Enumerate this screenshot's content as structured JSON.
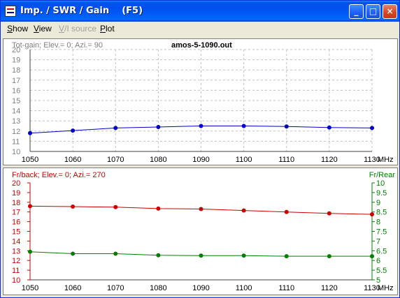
{
  "window": {
    "title": "Imp. / SWR / Gain    (F5)",
    "controls": {
      "minimize": "_",
      "maximize": "□",
      "close": "×"
    }
  },
  "menu": {
    "items": [
      {
        "label": "Show",
        "mnemonic": "S",
        "rest": "how",
        "enabled": true
      },
      {
        "label": "View",
        "mnemonic": "V",
        "rest": "iew",
        "enabled": true
      },
      {
        "label": "V/I source",
        "mnemonic": "V",
        "rest": "/I source",
        "enabled": false
      },
      {
        "label": "Plot",
        "mnemonic": "P",
        "rest": "lot",
        "enabled": true
      }
    ]
  },
  "colors": {
    "gain": "#0000cc",
    "frback": "#cc0000",
    "frrear": "#008000",
    "grid": "#c0c0c0",
    "axis_label": "#808080"
  },
  "chart_data": [
    {
      "type": "line",
      "title": "amos-5-1090.out",
      "subtitle": "Tot-gain; Elev.= 0; Azi.= 90",
      "xlabel": "MHz",
      "x": [
        1050,
        1060,
        1070,
        1080,
        1090,
        1100,
        1110,
        1120,
        1130
      ],
      "xlim": [
        1050,
        1130
      ],
      "ylim": [
        10,
        20
      ],
      "yticks": [
        10,
        11,
        12,
        13,
        14,
        15,
        16,
        17,
        18,
        19,
        20
      ],
      "grid": true,
      "series": [
        {
          "values": [
            11.8,
            12.05,
            12.3,
            12.4,
            12.5,
            12.5,
            12.45,
            12.35,
            12.3
          ]
        }
      ]
    },
    {
      "type": "line",
      "subtitle": "Fr/back; Elev.= 0; Azi.= 270",
      "right_axis_label": "Fr/Rear",
      "xlabel": "MHz",
      "x": [
        1050,
        1060,
        1070,
        1080,
        1090,
        1100,
        1110,
        1120,
        1130
      ],
      "xlim": [
        1050,
        1130
      ],
      "ylim": [
        10,
        20
      ],
      "yticks": [
        10,
        11,
        12,
        13,
        14,
        15,
        16,
        17,
        18,
        19,
        20
      ],
      "ylim_right": [
        5,
        10
      ],
      "yticks_right": [
        "5",
        "5.5",
        "6",
        "6.5",
        "7",
        "7.5",
        "8",
        "8.5",
        "9",
        "9.5",
        "10"
      ],
      "grid": false,
      "series": [
        {
          "axis": "left",
          "values": [
            17.6,
            17.55,
            17.5,
            17.35,
            17.3,
            17.15,
            17.0,
            16.85,
            16.75
          ]
        },
        {
          "axis": "right",
          "values": [
            6.45,
            6.35,
            6.35,
            6.27,
            6.25,
            6.25,
            6.22,
            6.22,
            6.22
          ]
        }
      ]
    }
  ]
}
